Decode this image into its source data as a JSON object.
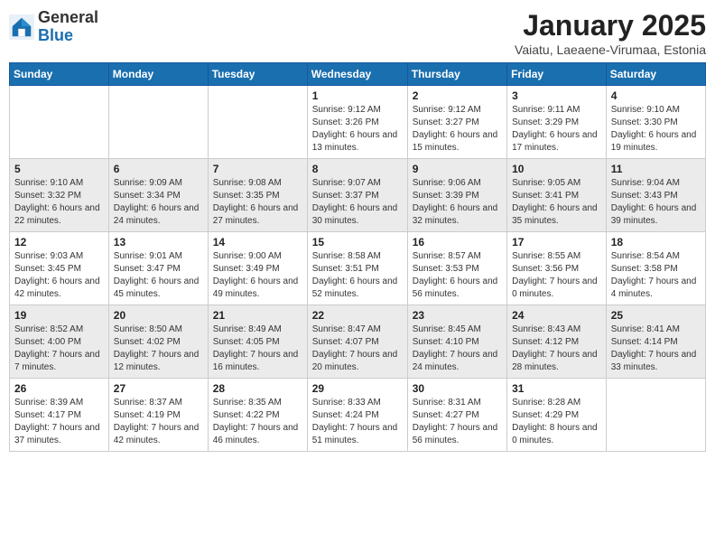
{
  "logo": {
    "general": "General",
    "blue": "Blue"
  },
  "title": "January 2025",
  "subtitle": "Vaiatu, Laeaene-Virumaa, Estonia",
  "days_of_week": [
    "Sunday",
    "Monday",
    "Tuesday",
    "Wednesday",
    "Thursday",
    "Friday",
    "Saturday"
  ],
  "weeks": [
    [
      {
        "day": "",
        "sunrise": "",
        "sunset": "",
        "daylight": ""
      },
      {
        "day": "",
        "sunrise": "",
        "sunset": "",
        "daylight": ""
      },
      {
        "day": "",
        "sunrise": "",
        "sunset": "",
        "daylight": ""
      },
      {
        "day": "1",
        "sunrise": "Sunrise: 9:12 AM",
        "sunset": "Sunset: 3:26 PM",
        "daylight": "Daylight: 6 hours and 13 minutes."
      },
      {
        "day": "2",
        "sunrise": "Sunrise: 9:12 AM",
        "sunset": "Sunset: 3:27 PM",
        "daylight": "Daylight: 6 hours and 15 minutes."
      },
      {
        "day": "3",
        "sunrise": "Sunrise: 9:11 AM",
        "sunset": "Sunset: 3:29 PM",
        "daylight": "Daylight: 6 hours and 17 minutes."
      },
      {
        "day": "4",
        "sunrise": "Sunrise: 9:10 AM",
        "sunset": "Sunset: 3:30 PM",
        "daylight": "Daylight: 6 hours and 19 minutes."
      }
    ],
    [
      {
        "day": "5",
        "sunrise": "Sunrise: 9:10 AM",
        "sunset": "Sunset: 3:32 PM",
        "daylight": "Daylight: 6 hours and 22 minutes."
      },
      {
        "day": "6",
        "sunrise": "Sunrise: 9:09 AM",
        "sunset": "Sunset: 3:34 PM",
        "daylight": "Daylight: 6 hours and 24 minutes."
      },
      {
        "day": "7",
        "sunrise": "Sunrise: 9:08 AM",
        "sunset": "Sunset: 3:35 PM",
        "daylight": "Daylight: 6 hours and 27 minutes."
      },
      {
        "day": "8",
        "sunrise": "Sunrise: 9:07 AM",
        "sunset": "Sunset: 3:37 PM",
        "daylight": "Daylight: 6 hours and 30 minutes."
      },
      {
        "day": "9",
        "sunrise": "Sunrise: 9:06 AM",
        "sunset": "Sunset: 3:39 PM",
        "daylight": "Daylight: 6 hours and 32 minutes."
      },
      {
        "day": "10",
        "sunrise": "Sunrise: 9:05 AM",
        "sunset": "Sunset: 3:41 PM",
        "daylight": "Daylight: 6 hours and 35 minutes."
      },
      {
        "day": "11",
        "sunrise": "Sunrise: 9:04 AM",
        "sunset": "Sunset: 3:43 PM",
        "daylight": "Daylight: 6 hours and 39 minutes."
      }
    ],
    [
      {
        "day": "12",
        "sunrise": "Sunrise: 9:03 AM",
        "sunset": "Sunset: 3:45 PM",
        "daylight": "Daylight: 6 hours and 42 minutes."
      },
      {
        "day": "13",
        "sunrise": "Sunrise: 9:01 AM",
        "sunset": "Sunset: 3:47 PM",
        "daylight": "Daylight: 6 hours and 45 minutes."
      },
      {
        "day": "14",
        "sunrise": "Sunrise: 9:00 AM",
        "sunset": "Sunset: 3:49 PM",
        "daylight": "Daylight: 6 hours and 49 minutes."
      },
      {
        "day": "15",
        "sunrise": "Sunrise: 8:58 AM",
        "sunset": "Sunset: 3:51 PM",
        "daylight": "Daylight: 6 hours and 52 minutes."
      },
      {
        "day": "16",
        "sunrise": "Sunrise: 8:57 AM",
        "sunset": "Sunset: 3:53 PM",
        "daylight": "Daylight: 6 hours and 56 minutes."
      },
      {
        "day": "17",
        "sunrise": "Sunrise: 8:55 AM",
        "sunset": "Sunset: 3:56 PM",
        "daylight": "Daylight: 7 hours and 0 minutes."
      },
      {
        "day": "18",
        "sunrise": "Sunrise: 8:54 AM",
        "sunset": "Sunset: 3:58 PM",
        "daylight": "Daylight: 7 hours and 4 minutes."
      }
    ],
    [
      {
        "day": "19",
        "sunrise": "Sunrise: 8:52 AM",
        "sunset": "Sunset: 4:00 PM",
        "daylight": "Daylight: 7 hours and 7 minutes."
      },
      {
        "day": "20",
        "sunrise": "Sunrise: 8:50 AM",
        "sunset": "Sunset: 4:02 PM",
        "daylight": "Daylight: 7 hours and 12 minutes."
      },
      {
        "day": "21",
        "sunrise": "Sunrise: 8:49 AM",
        "sunset": "Sunset: 4:05 PM",
        "daylight": "Daylight: 7 hours and 16 minutes."
      },
      {
        "day": "22",
        "sunrise": "Sunrise: 8:47 AM",
        "sunset": "Sunset: 4:07 PM",
        "daylight": "Daylight: 7 hours and 20 minutes."
      },
      {
        "day": "23",
        "sunrise": "Sunrise: 8:45 AM",
        "sunset": "Sunset: 4:10 PM",
        "daylight": "Daylight: 7 hours and 24 minutes."
      },
      {
        "day": "24",
        "sunrise": "Sunrise: 8:43 AM",
        "sunset": "Sunset: 4:12 PM",
        "daylight": "Daylight: 7 hours and 28 minutes."
      },
      {
        "day": "25",
        "sunrise": "Sunrise: 8:41 AM",
        "sunset": "Sunset: 4:14 PM",
        "daylight": "Daylight: 7 hours and 33 minutes."
      }
    ],
    [
      {
        "day": "26",
        "sunrise": "Sunrise: 8:39 AM",
        "sunset": "Sunset: 4:17 PM",
        "daylight": "Daylight: 7 hours and 37 minutes."
      },
      {
        "day": "27",
        "sunrise": "Sunrise: 8:37 AM",
        "sunset": "Sunset: 4:19 PM",
        "daylight": "Daylight: 7 hours and 42 minutes."
      },
      {
        "day": "28",
        "sunrise": "Sunrise: 8:35 AM",
        "sunset": "Sunset: 4:22 PM",
        "daylight": "Daylight: 7 hours and 46 minutes."
      },
      {
        "day": "29",
        "sunrise": "Sunrise: 8:33 AM",
        "sunset": "Sunset: 4:24 PM",
        "daylight": "Daylight: 7 hours and 51 minutes."
      },
      {
        "day": "30",
        "sunrise": "Sunrise: 8:31 AM",
        "sunset": "Sunset: 4:27 PM",
        "daylight": "Daylight: 7 hours and 56 minutes."
      },
      {
        "day": "31",
        "sunrise": "Sunrise: 8:28 AM",
        "sunset": "Sunset: 4:29 PM",
        "daylight": "Daylight: 8 hours and 0 minutes."
      },
      {
        "day": "",
        "sunrise": "",
        "sunset": "",
        "daylight": ""
      }
    ]
  ]
}
